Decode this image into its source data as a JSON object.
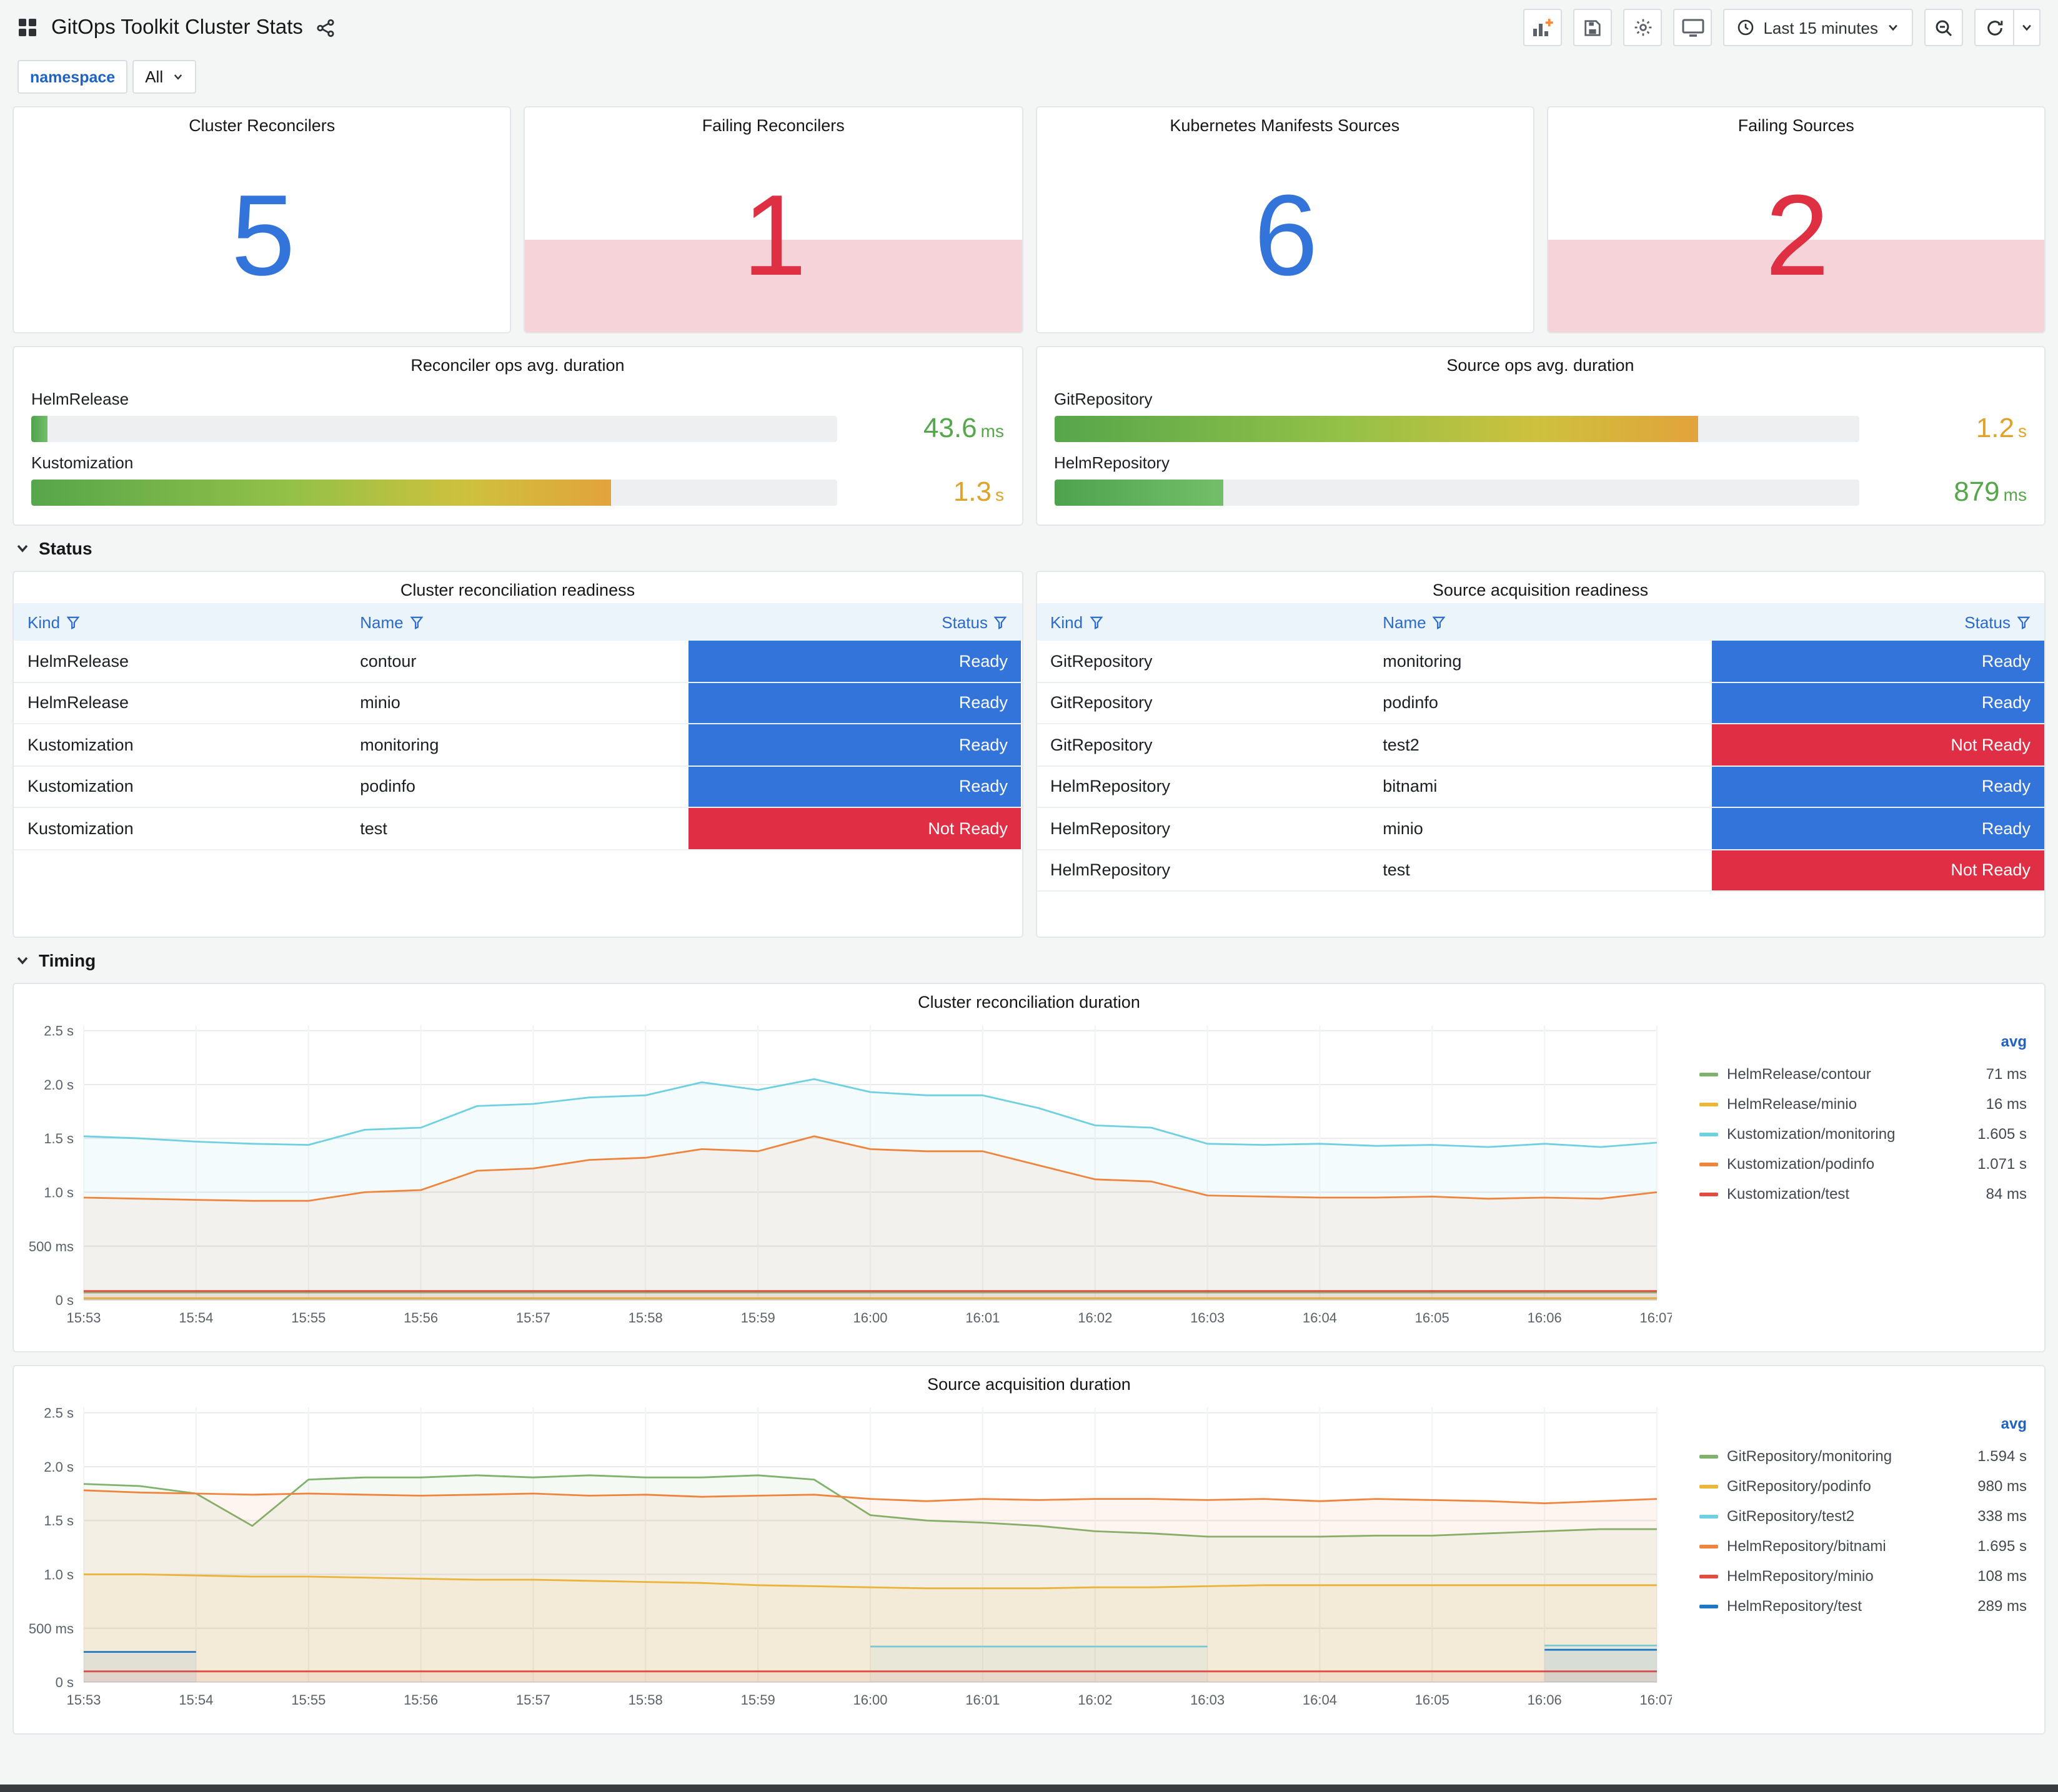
{
  "header": {
    "title": "GitOps Toolkit Cluster Stats",
    "time_range_label": "Last 15 minutes"
  },
  "variables": {
    "namespace_label": "namespace",
    "namespace_value": "All"
  },
  "sections": {
    "status": "Status",
    "timing": "Timing"
  },
  "colors": {
    "accent_blue": "#3274D9",
    "alert_red": "#E02F44",
    "alert_red_bg": "#F6D3D8",
    "green_text": "#56A64B",
    "yellow_text": "#DFA22B",
    "ready_bg": "#3274D9",
    "not_ready_bg": "#E02F44",
    "link_blue": "#1F62C4"
  },
  "stats": [
    {
      "title": "Cluster Reconcilers",
      "value": "5",
      "state": "ok"
    },
    {
      "title": "Failing Reconcilers",
      "value": "1",
      "state": "failing"
    },
    {
      "title": "Kubernetes Manifests Sources",
      "value": "6",
      "state": "ok"
    },
    {
      "title": "Failing Sources",
      "value": "2",
      "state": "failing"
    }
  ],
  "gauges": [
    {
      "title": "Reconciler ops avg. duration",
      "rows": [
        {
          "label": "HelmRelease",
          "value": "43.6",
          "unit": "ms",
          "percent": 2,
          "tone": "green"
        },
        {
          "label": "Kustomization",
          "value": "1.3",
          "unit": "s",
          "percent": 72,
          "tone": "yellow"
        }
      ]
    },
    {
      "title": "Source ops avg. duration",
      "rows": [
        {
          "label": "GitRepository",
          "value": "1.2",
          "unit": "s",
          "percent": 80,
          "tone": "yellow"
        },
        {
          "label": "HelmRepository",
          "value": "879",
          "unit": "ms",
          "percent": 21,
          "tone": "green"
        }
      ]
    }
  ],
  "tables": [
    {
      "title": "Cluster reconciliation readiness",
      "columns": [
        "Kind",
        "Name",
        "Status"
      ],
      "rows": [
        {
          "kind": "HelmRelease",
          "name": "contour",
          "status": "Ready"
        },
        {
          "kind": "HelmRelease",
          "name": "minio",
          "status": "Ready"
        },
        {
          "kind": "Kustomization",
          "name": "monitoring",
          "status": "Ready"
        },
        {
          "kind": "Kustomization",
          "name": "podinfo",
          "status": "Ready"
        },
        {
          "kind": "Kustomization",
          "name": "test",
          "status": "Not Ready"
        }
      ]
    },
    {
      "title": "Source acquisition readiness",
      "columns": [
        "Kind",
        "Name",
        "Status"
      ],
      "rows": [
        {
          "kind": "GitRepository",
          "name": "monitoring",
          "status": "Ready"
        },
        {
          "kind": "GitRepository",
          "name": "podinfo",
          "status": "Ready"
        },
        {
          "kind": "GitRepository",
          "name": "test2",
          "status": "Not Ready"
        },
        {
          "kind": "HelmRepository",
          "name": "bitnami",
          "status": "Ready"
        },
        {
          "kind": "HelmRepository",
          "name": "minio",
          "status": "Ready"
        },
        {
          "kind": "HelmRepository",
          "name": "test",
          "status": "Not Ready"
        }
      ]
    }
  ],
  "chart_data": [
    {
      "type": "line",
      "title": "Cluster reconciliation duration",
      "ylim": [
        0,
        2.5
      ],
      "legend_header": "avg",
      "yticks": [
        {
          "v": 0,
          "label": "0 s"
        },
        {
          "v": 0.5,
          "label": "500 ms"
        },
        {
          "v": 1,
          "label": "1.0 s"
        },
        {
          "v": 1.5,
          "label": "1.5 s"
        },
        {
          "v": 2,
          "label": "2.0 s"
        },
        {
          "v": 2.5,
          "label": "2.5 s"
        }
      ],
      "xticks": [
        "15:53",
        "15:54",
        "15:55",
        "15:56",
        "15:57",
        "15:58",
        "15:59",
        "16:00",
        "16:01",
        "16:02",
        "16:03",
        "16:04",
        "16:05",
        "16:06",
        "16:07"
      ],
      "series": [
        {
          "name": "HelmRelease/contour",
          "color": "#7EB26D",
          "avg": "71 ms",
          "values": [
            0.07,
            0.07
          ]
        },
        {
          "name": "HelmRelease/minio",
          "color": "#EAB839",
          "avg": "16 ms",
          "values": [
            0.016,
            0.016
          ]
        },
        {
          "name": "Kustomization/monitoring",
          "color": "#6ED0E0",
          "avg": "1.605 s",
          "values": [
            1.52,
            1.5,
            1.47,
            1.45,
            1.44,
            1.58,
            1.6,
            1.8,
            1.82,
            1.88,
            1.9,
            2.02,
            1.95,
            2.05,
            1.93,
            1.9,
            1.9,
            1.78,
            1.62,
            1.6,
            1.45,
            1.44,
            1.45,
            1.43,
            1.44,
            1.42,
            1.45,
            1.42,
            1.46
          ]
        },
        {
          "name": "Kustomization/podinfo",
          "color": "#EF843C",
          "avg": "1.071 s",
          "values": [
            0.95,
            0.94,
            0.93,
            0.92,
            0.92,
            1.0,
            1.02,
            1.2,
            1.22,
            1.3,
            1.32,
            1.4,
            1.38,
            1.52,
            1.4,
            1.38,
            1.38,
            1.25,
            1.12,
            1.1,
            0.97,
            0.96,
            0.95,
            0.95,
            0.96,
            0.94,
            0.95,
            0.94,
            1.0
          ]
        },
        {
          "name": "Kustomization/test",
          "color": "#E24D42",
          "avg": "84 ms",
          "values": [
            0.084,
            0.084
          ]
        }
      ]
    },
    {
      "type": "line",
      "title": "Source acquisition duration",
      "ylim": [
        0,
        2.5
      ],
      "legend_header": "avg",
      "yticks": [
        {
          "v": 0,
          "label": "0 s"
        },
        {
          "v": 0.5,
          "label": "500 ms"
        },
        {
          "v": 1,
          "label": "1.0 s"
        },
        {
          "v": 1.5,
          "label": "1.5 s"
        },
        {
          "v": 2,
          "label": "2.0 s"
        },
        {
          "v": 2.5,
          "label": "2.5 s"
        }
      ],
      "xticks": [
        "15:53",
        "15:54",
        "15:55",
        "15:56",
        "15:57",
        "15:58",
        "15:59",
        "16:00",
        "16:01",
        "16:02",
        "16:03",
        "16:04",
        "16:05",
        "16:06",
        "16:07"
      ],
      "series": [
        {
          "name": "GitRepository/monitoring",
          "color": "#7EB26D",
          "avg": "1.594 s",
          "values": [
            1.84,
            1.82,
            1.75,
            1.45,
            1.88,
            1.9,
            1.9,
            1.92,
            1.9,
            1.92,
            1.9,
            1.9,
            1.92,
            1.88,
            1.55,
            1.5,
            1.48,
            1.45,
            1.4,
            1.38,
            1.35,
            1.35,
            1.35,
            1.36,
            1.36,
            1.38,
            1.4,
            1.42,
            1.42
          ]
        },
        {
          "name": "GitRepository/podinfo",
          "color": "#EAB839",
          "avg": "980 ms",
          "values": [
            1.0,
            1.0,
            0.99,
            0.98,
            0.98,
            0.97,
            0.96,
            0.95,
            0.95,
            0.94,
            0.93,
            0.92,
            0.9,
            0.89,
            0.88,
            0.87,
            0.87,
            0.87,
            0.88,
            0.88,
            0.89,
            0.9,
            0.9,
            0.9,
            0.9,
            0.9,
            0.9,
            0.9,
            0.9
          ]
        },
        {
          "name": "GitRepository/test2",
          "color": "#6ED0E0",
          "avg": "338 ms",
          "values": [
            null,
            null,
            null,
            null,
            null,
            null,
            null,
            null,
            null,
            null,
            null,
            null,
            null,
            null,
            0.33,
            0.33,
            0.33,
            0.33,
            0.33,
            0.33,
            0.33,
            null,
            null,
            null,
            null,
            null,
            0.34,
            0.34,
            0.34
          ]
        },
        {
          "name": "HelmRepository/bitnami",
          "color": "#EF843C",
          "avg": "1.695 s",
          "values": [
            1.78,
            1.76,
            1.75,
            1.74,
            1.75,
            1.74,
            1.73,
            1.74,
            1.75,
            1.73,
            1.74,
            1.72,
            1.73,
            1.74,
            1.7,
            1.68,
            1.7,
            1.69,
            1.7,
            1.7,
            1.69,
            1.7,
            1.68,
            1.7,
            1.69,
            1.68,
            1.66,
            1.68,
            1.7
          ]
        },
        {
          "name": "HelmRepository/minio",
          "color": "#E24D42",
          "avg": "108 ms",
          "values": [
            0.1,
            0.1
          ]
        },
        {
          "name": "HelmRepository/test",
          "color": "#1F78C1",
          "avg": "289 ms",
          "values": [
            0.28,
            0.28,
            0.28,
            null,
            null,
            null,
            null,
            null,
            null,
            null,
            null,
            null,
            null,
            null,
            null,
            null,
            null,
            null,
            null,
            null,
            null,
            null,
            null,
            null,
            null,
            null,
            0.3,
            0.3,
            0.3
          ]
        }
      ]
    }
  ]
}
